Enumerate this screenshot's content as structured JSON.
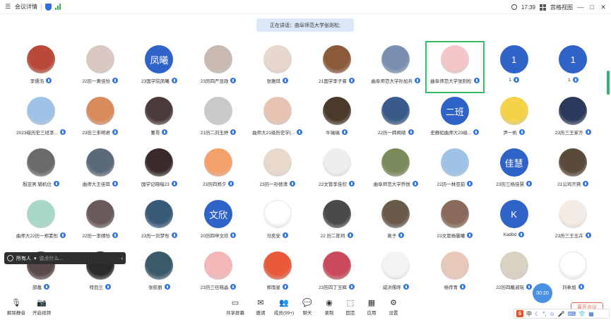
{
  "topbar": {
    "meeting_details": "会议详情",
    "time": "17:39",
    "view_mode": "宫格视图",
    "minimize": "—",
    "maximize": "□",
    "close": "✕"
  },
  "speaker_banner": "正在讲话：曲阜师范大学张则松;",
  "participants": [
    {
      "name": "李儒浩",
      "avatar_text": "",
      "color": "#b94a3a"
    },
    {
      "name": "22历一黄佳怡",
      "avatar_text": "",
      "color": "#d9c9c2"
    },
    {
      "name": "23国学院凤曦",
      "avatar_text": "凤曦",
      "color": "#2f63c8"
    },
    {
      "name": "23历四严显政",
      "avatar_text": "",
      "color": "#c9b9b0"
    },
    {
      "name": "张雅琪",
      "avatar_text": "",
      "color": "#e8d7cc"
    },
    {
      "name": "21国学李子睿",
      "avatar_text": "",
      "color": "#8b5a3a"
    },
    {
      "name": "曲阜师范大学孙加兵",
      "avatar_text": "",
      "color": "#7a8fb0"
    },
    {
      "name": "曲阜师范大学张则松",
      "avatar_text": "",
      "color": "#f3c7c7"
    },
    {
      "name": "1",
      "avatar_text": "1",
      "color": "#2f63c8"
    },
    {
      "name": "1",
      "avatar_text": "1",
      "color": "#2f63c8"
    },
    {
      "name": "2023级历史三班李...",
      "avatar_text": "",
      "color": "#9ec3e6"
    },
    {
      "name": "23历三朱明君",
      "avatar_text": "",
      "color": "#d98a5a"
    },
    {
      "name": "董哥",
      "avatar_text": "",
      "color": "#4a3a3a"
    },
    {
      "name": "21历二刘玉婷",
      "avatar_text": "",
      "color": "#c9c9c9"
    },
    {
      "name": "曲师大21级历史学(...",
      "avatar_text": "",
      "color": "#e8c3b3"
    },
    {
      "name": "牛瑞瑞",
      "avatar_text": "",
      "color": "#4a3a2a"
    },
    {
      "name": "22历一韩朔硕",
      "avatar_text": "",
      "color": "#3a5a8a"
    },
    {
      "name": "史静如曲师大23级...",
      "avatar_text": "二班",
      "color": "#2f63c8"
    },
    {
      "name": "尹一帆",
      "avatar_text": "",
      "color": "#f4d24a"
    },
    {
      "name": "23历三王家齐",
      "avatar_text": "",
      "color": "#2a3a5a"
    },
    {
      "name": "殷亚男 辅机位",
      "avatar_text": "",
      "color": "#6a6a6a"
    },
    {
      "name": "曲师大王佳琪",
      "avatar_text": "",
      "color": "#5a6a7a"
    },
    {
      "name": "国学记晓暗23",
      "avatar_text": "",
      "color": "#3a2a2a"
    },
    {
      "name": "23历四郑夕",
      "avatar_text": "",
      "color": "#f4a06a"
    },
    {
      "name": "23历一孙德清",
      "avatar_text": "",
      "color": "#e8d9cc"
    },
    {
      "name": "22文管李佳欣",
      "avatar_text": "",
      "color": "#eeeeee"
    },
    {
      "name": "曲阜师范大学乔悦",
      "avatar_text": "",
      "color": "#7a8a5a"
    },
    {
      "name": "22历一林亚茹",
      "avatar_text": "",
      "color": "#9ec3e6"
    },
    {
      "name": "23历三杨佳慧",
      "avatar_text": "佳慧",
      "color": "#2f63c8"
    },
    {
      "name": "21公鸡齐爽",
      "avatar_text": "",
      "color": "#5a4a3a"
    },
    {
      "name": "曲师大22历一郑素彤",
      "avatar_text": "",
      "color": "#a8d8c8"
    },
    {
      "name": "22历一李婧怡",
      "avatar_text": "",
      "color": "#6a5a5a"
    },
    {
      "name": "23历一刘梦彤",
      "avatar_text": "",
      "color": "#3a5a7a"
    },
    {
      "name": "20历四申文欣",
      "avatar_text": "文欣",
      "color": "#2f63c8"
    },
    {
      "name": "马奕安",
      "avatar_text": "",
      "color": "#ffffff"
    },
    {
      "name": "22 历二陈珂",
      "avatar_text": "",
      "color": "#4a4a4a"
    },
    {
      "name": "离子",
      "avatar_text": "",
      "color": "#6a5a4a"
    },
    {
      "name": "23文管杨馨曦",
      "avatar_text": "",
      "color": "#8a6a5a"
    },
    {
      "name": "Kadbd",
      "avatar_text": "K",
      "color": "#2f63c8"
    },
    {
      "name": "23历三王玉卉",
      "avatar_text": "",
      "color": "#f4ece6"
    },
    {
      "name": "邵嘉",
      "avatar_text": "",
      "color": "#5a4a4a"
    },
    {
      "name": "特目兰",
      "avatar_text": "",
      "color": "#2a2a2a"
    },
    {
      "name": "张航丽",
      "avatar_text": "",
      "color": "#3a5a6a"
    },
    {
      "name": "23历三任晓晶",
      "avatar_text": "",
      "color": "#f4b8b8"
    },
    {
      "name": "郑雨星",
      "avatar_text": "",
      "color": "#e85a3a"
    },
    {
      "name": "23历四丁玉辉",
      "avatar_text": "",
      "color": "#c94a5a"
    },
    {
      "name": "威洪儒呼",
      "avatar_text": "",
      "color": "#f4f4f4"
    },
    {
      "name": "杨传青",
      "avatar_text": "",
      "color": "#e8c8b8"
    },
    {
      "name": "22历四戴淑瑶",
      "avatar_text": "",
      "color": "#d9d2c2"
    },
    {
      "name": "刘奉旭",
      "avatar_text": "",
      "color": "#ffffff"
    }
  ],
  "chat_popup": {
    "target": "所有人",
    "placeholder": "说点什么..."
  },
  "timer": "00:20",
  "bottombar": {
    "unmute": "解除静音",
    "start_video": "开启视频",
    "share_screen": "共享屏幕",
    "invite": "邀请",
    "members": "成员(99+)",
    "chat": "聊天",
    "record": "录制",
    "fixed": "固定",
    "apps": "应用",
    "settings": "设置",
    "leave": "离开会议"
  },
  "ime": {
    "logo": "S",
    "lang": "中"
  },
  "colors": {
    "accent": "#2f63c8",
    "active_border": "#3cba6b",
    "leave": "#e06a5a"
  }
}
